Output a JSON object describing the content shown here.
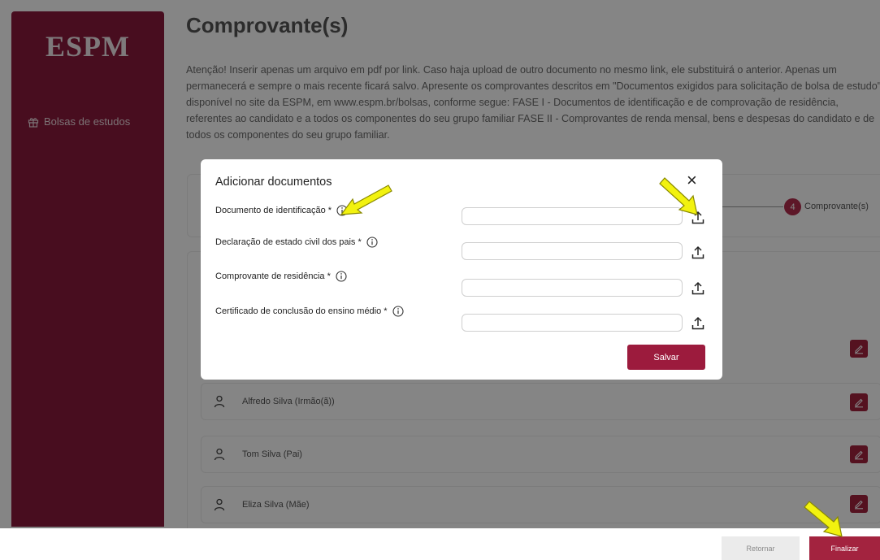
{
  "sidebar": {
    "logo": "ESPM",
    "items": [
      {
        "label": "Bolsas de estudos",
        "icon": "gift-icon"
      }
    ]
  },
  "main": {
    "title": "Comprovante(s)",
    "description": "Atenção! Inserir apenas um arquivo em pdf por link. Caso haja upload de outro documento no mesmo link, ele substituirá o anterior. Apenas um permanecerá e sempre o mais recente ficará salvo. Apresente os comprovantes descritos em \"Documentos exigidos para solicitação de bolsa de estudo\", disponível no site da ESPM, em www.espm.br/bolsas, conforme segue: FASE I - Documentos de identificação e de comprovação de residência, referentes ao candidato e a todos os componentes do seu grupo familiar FASE II - Comprovantes de renda mensal, bens e despesas do candidato e de todos os componentes do seu grupo familiar.",
    "stepper": {
      "number": "4",
      "label": "Comprovante(s)"
    },
    "members": [
      {
        "name": "Alfredo Silva (Irmão(ã))"
      },
      {
        "name": "Tom Silva (Pai)"
      },
      {
        "name": "Eliza Silva (Mãe)"
      }
    ]
  },
  "modal": {
    "title": "Adicionar documentos",
    "close": "×",
    "fields": [
      {
        "label": "Documento de identificação *",
        "value": "",
        "placeholder": ""
      },
      {
        "label": "Declaração de estado civil dos pais *",
        "value": "",
        "placeholder": ""
      },
      {
        "label": "Comprovante de residência *",
        "value": "",
        "placeholder": ""
      },
      {
        "label": "Certificado de conclusão do ensino médio *",
        "value": "",
        "placeholder": ""
      }
    ],
    "save_label": "Salvar"
  },
  "footer": {
    "back_label": "Retornar",
    "finish_label": "Finalizar"
  },
  "colors": {
    "brand": "#8b1a3c",
    "accent": "#9c1b3d",
    "highlight_arrow": "#f2f20f"
  }
}
